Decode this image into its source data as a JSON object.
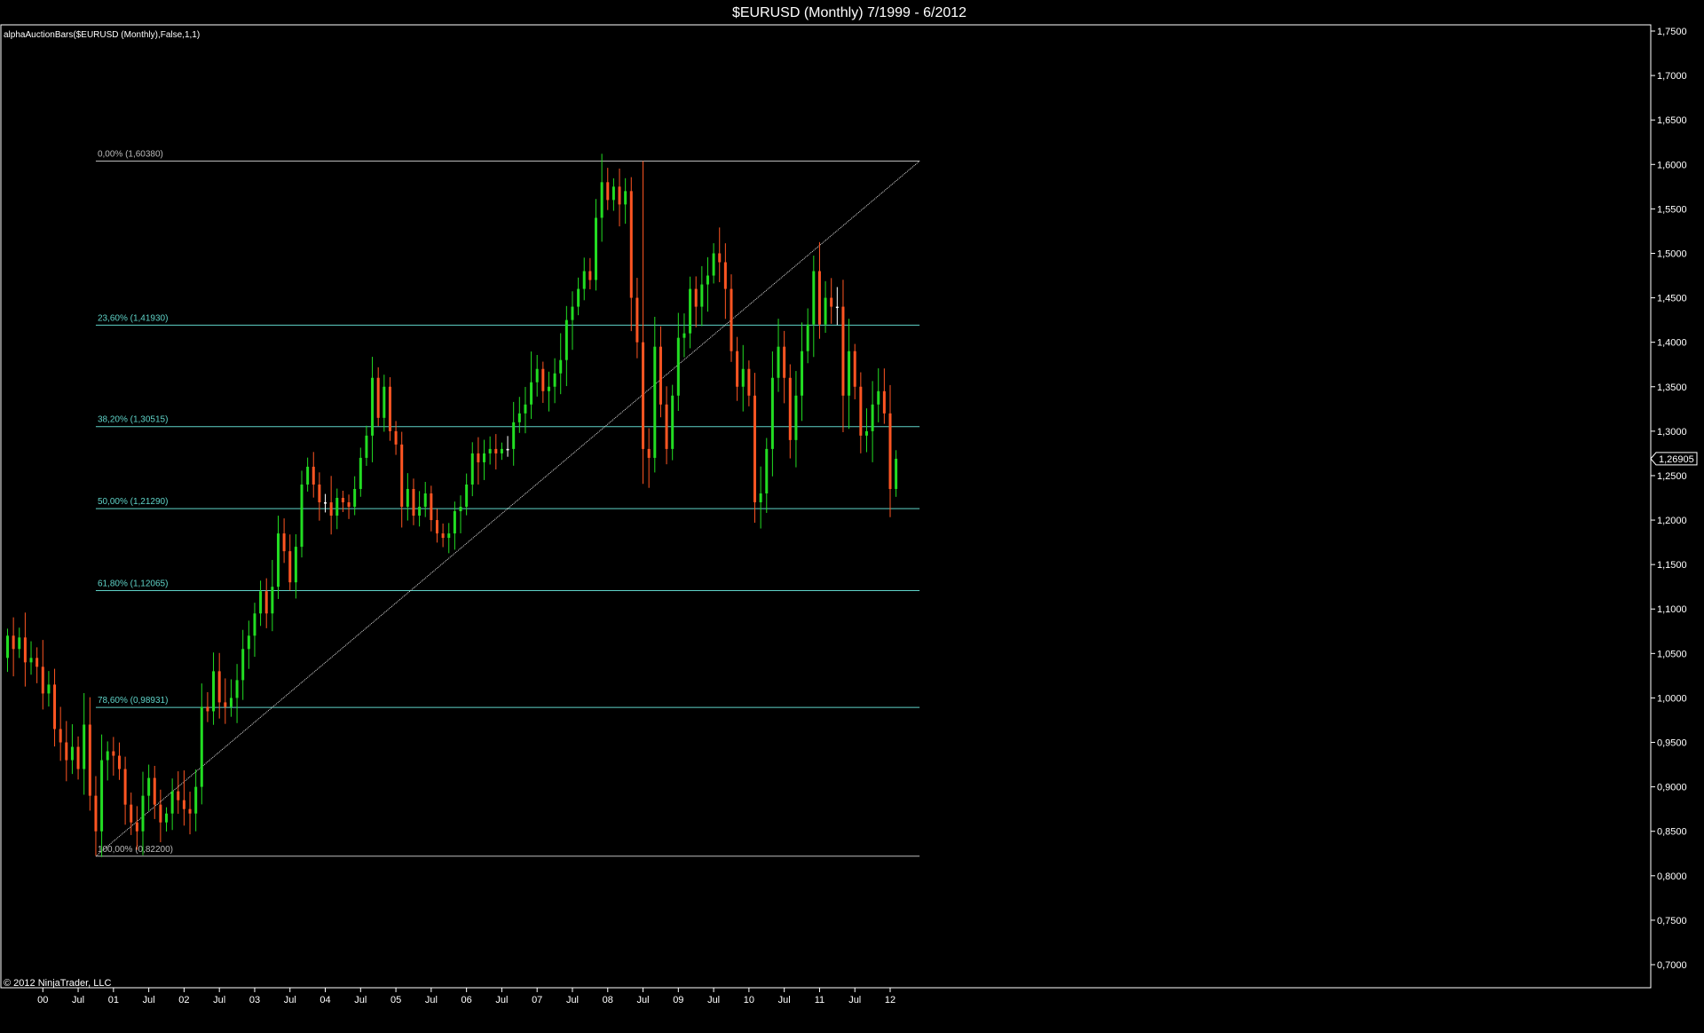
{
  "window": {
    "title": "$EURUSD (Monthly)  7/1999 - 6/2012",
    "indicator_label": "alphaAuctionBars($EURUSD (Monthly),False,1,1)",
    "copyright": "© 2012 NinjaTrader, LLC"
  },
  "chart_data": {
    "type": "candlestick",
    "title": "$EURUSD (Monthly)  7/1999 - 6/2012",
    "instrument": "$EURUSD",
    "period": "Monthly",
    "date_range": [
      "1999-07",
      "2012-06"
    ],
    "xlabel": "",
    "ylabel": "",
    "ylim": [
      0.675,
      1.75
    ],
    "grid": false,
    "colors": {
      "background": "#000000",
      "up_candle": "#22dd22",
      "down_candle": "#ff5522",
      "doji": "#ffffff",
      "fib_line": "#5fd3c8",
      "fib_label": "#5fd3c8",
      "fib_extreme": "#bbbbbb",
      "trendline": "#dddddd",
      "axis": "#ffffff"
    },
    "y_ticks": [
      "1,7500",
      "1,7000",
      "1,6500",
      "1,6000",
      "1,5500",
      "1,5000",
      "1,4500",
      "1,4000",
      "1,3500",
      "1,3000",
      "1,2500",
      "1,2000",
      "1,1500",
      "1,1000",
      "1,0500",
      "1,0000",
      "0,9500",
      "0,9000",
      "0,8500",
      "0,8000",
      "0,7500",
      "0,7000"
    ],
    "y_tick_values": [
      1.75,
      1.7,
      1.65,
      1.6,
      1.55,
      1.5,
      1.45,
      1.4,
      1.35,
      1.3,
      1.25,
      1.2,
      1.15,
      1.1,
      1.05,
      1.0,
      0.95,
      0.9,
      0.85,
      0.8,
      0.75,
      0.7
    ],
    "x_ticks": [
      {
        "label": "00",
        "month": 6
      },
      {
        "label": "Jul",
        "month": 12
      },
      {
        "label": "01",
        "month": 18
      },
      {
        "label": "Jul",
        "month": 24
      },
      {
        "label": "02",
        "month": 30
      },
      {
        "label": "Jul",
        "month": 36
      },
      {
        "label": "03",
        "month": 42
      },
      {
        "label": "Jul",
        "month": 48
      },
      {
        "label": "04",
        "month": 54
      },
      {
        "label": "Jul",
        "month": 60
      },
      {
        "label": "05",
        "month": 66
      },
      {
        "label": "Jul",
        "month": 72
      },
      {
        "label": "06",
        "month": 78
      },
      {
        "label": "Jul",
        "month": 84
      },
      {
        "label": "07",
        "month": 90
      },
      {
        "label": "Jul",
        "month": 96
      },
      {
        "label": "08",
        "month": 102
      },
      {
        "label": "Jul",
        "month": 108
      },
      {
        "label": "09",
        "month": 114
      },
      {
        "label": "Jul",
        "month": 120
      },
      {
        "label": "10",
        "month": 126
      },
      {
        "label": "Jul",
        "month": 132
      },
      {
        "label": "11",
        "month": 138
      },
      {
        "label": "Jul",
        "month": 144
      },
      {
        "label": "12",
        "month": 150
      }
    ],
    "last_price": "1,26905",
    "last_price_value": 1.26905,
    "fib_levels": [
      {
        "label": "0,00% (1,60380)",
        "value": 1.6038,
        "extreme": true
      },
      {
        "label": "23,60% (1,41930)",
        "value": 1.4193,
        "extreme": false
      },
      {
        "label": "38,20% (1,30515)",
        "value": 1.30515,
        "extreme": false
      },
      {
        "label": "50,00% (1,21290)",
        "value": 1.2129,
        "extreme": false
      },
      {
        "label": "61,80% (1,12065)",
        "value": 1.12065,
        "extreme": false
      },
      {
        "label": "78,60% (0,98931)",
        "value": 0.98931,
        "extreme": false
      },
      {
        "label": "100,00% (0,82200)",
        "value": 0.822,
        "extreme": true
      }
    ],
    "fib_start_month": 15,
    "fib_end_month": 155,
    "trendline": {
      "from": {
        "month": 15,
        "value": 0.822
      },
      "to": {
        "month": 155,
        "value": 1.6038
      }
    },
    "close": [
      1.07,
      1.055,
      1.068,
      1.04,
      1.045,
      1.035,
      1.005,
      1.015,
      0.965,
      0.95,
      0.93,
      0.945,
      0.92,
      0.97,
      0.89,
      0.85,
      0.93,
      0.94,
      0.935,
      0.92,
      0.88,
      0.86,
      0.85,
      0.89,
      0.91,
      0.88,
      0.86,
      0.87,
      0.895,
      0.885,
      0.875,
      0.87,
      0.9,
      0.99,
      0.985,
      1.03,
      0.995,
      0.99,
      1.0,
      1.02,
      1.055,
      1.07,
      1.095,
      1.12,
      1.095,
      1.125,
      1.185,
      1.165,
      1.13,
      1.17,
      1.24,
      1.26,
      1.24,
      1.22,
      1.22,
      1.205,
      1.225,
      1.22,
      1.215,
      1.235,
      1.27,
      1.295,
      1.36,
      1.315,
      1.35,
      1.3,
      1.285,
      1.215,
      1.235,
      1.205,
      1.215,
      1.23,
      1.2,
      1.185,
      1.18,
      1.185,
      1.21,
      1.215,
      1.24,
      1.275,
      1.265,
      1.275,
      1.28,
      1.275,
      1.28,
      1.28,
      1.31,
      1.32,
      1.33,
      1.355,
      1.37,
      1.345,
      1.35,
      1.365,
      1.38,
      1.425,
      1.44,
      1.46,
      1.48,
      1.47,
      1.54,
      1.58,
      1.56,
      1.575,
      1.555,
      1.57,
      1.45,
      1.4,
      1.28,
      1.27,
      1.395,
      1.33,
      1.28,
      1.34,
      1.405,
      1.41,
      1.46,
      1.44,
      1.465,
      1.475,
      1.5,
      1.49,
      1.46,
      1.39,
      1.35,
      1.37,
      1.34,
      1.22,
      1.23,
      1.28,
      1.36,
      1.395,
      1.36,
      1.29,
      1.34,
      1.39,
      1.42,
      1.48,
      1.42,
      1.45,
      1.44,
      1.44,
      1.34,
      1.39,
      1.35,
      1.295,
      1.3,
      1.33,
      1.345,
      1.32,
      1.235,
      1.269
    ],
    "value_note": "Close price per month, 156 months from Jul 1999 (month 0) to Jun 2012 (month 155); open of each month equals previous close."
  }
}
